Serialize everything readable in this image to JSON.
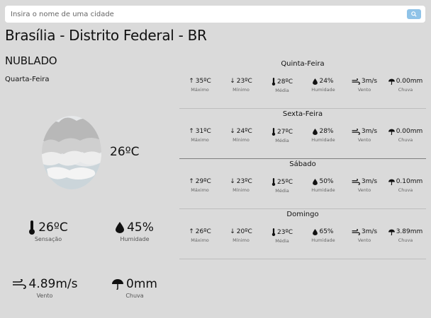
{
  "search": {
    "placeholder": "Insira o nome de uma cidade"
  },
  "location": {
    "title": "Brasília - Distrito Federal - BR"
  },
  "current": {
    "condition": "NUBLADO",
    "day": "Quarta-Feira",
    "temp": "26ºC",
    "weather_icon": "cloudy-icon",
    "stats": {
      "sensacao": {
        "value": "26ºC",
        "label": "Sensação"
      },
      "humidade": {
        "value": "45%",
        "label": "Humidade"
      },
      "vento": {
        "value": "4.89m/s",
        "label": "Vento"
      },
      "chuva": {
        "value": "0mm",
        "label": "Chuva"
      }
    }
  },
  "forecast": [
    {
      "day": "Quinta-Feira",
      "max": "35ºC",
      "min": "23ºC",
      "media": "28ºC",
      "humidade": "24%",
      "vento": "3m/s",
      "chuva": "0.00mm"
    },
    {
      "day": "Sexta-Feira",
      "max": "31ºC",
      "min": "24ºC",
      "media": "27ºC",
      "humidade": "28%",
      "vento": "3m/s",
      "chuva": "0.00mm"
    },
    {
      "day": "Sábado",
      "max": "29ºC",
      "min": "23ºC",
      "media": "25ºC",
      "humidade": "50%",
      "vento": "3m/s",
      "chuva": "0.10mm"
    },
    {
      "day": "Domingo",
      "max": "26ºC",
      "min": "20ºC",
      "media": "23ºC",
      "humidade": "65%",
      "vento": "3m/s",
      "chuva": "3.89mm"
    }
  ],
  "labels": {
    "max": "Máximo",
    "min": "Mínimo",
    "media": "Média",
    "humidade": "Humidade",
    "vento": "Vento",
    "chuva": "Chuva"
  },
  "colors": {
    "background": "#dadada",
    "search_button": "#8fc3e8"
  }
}
